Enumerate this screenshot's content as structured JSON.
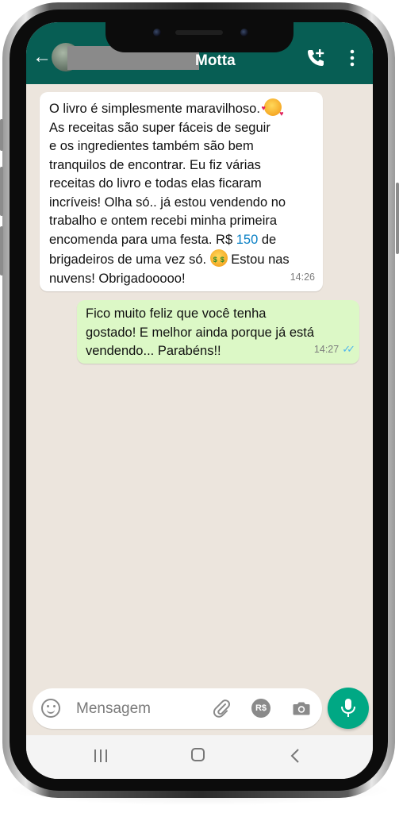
{
  "header": {
    "contact_name": "Motta",
    "accent_color": "#075e54",
    "icons": [
      "back-arrow-icon",
      "avatar",
      "add-call-icon",
      "more-vert-icon"
    ]
  },
  "messages": [
    {
      "direction": "incoming",
      "lines": [
        "O livro é simplesmente maravilhoso.",
        "As receitas são super fáceis de seguir",
        "e os ingredientes também são bem",
        "tranquilos de encontrar. Eu fiz várias",
        "receitas do livro e todas elas ficaram",
        "incríveis! Olha só.. já estou vendendo no",
        "trabalho e ontem recebi minha primeira",
        "encomenda para uma festa. R$",
        "150",
        "de",
        "brigadeiros de uma vez só.",
        "Estou nas",
        "nuvens! Obrigadooooo!"
      ],
      "time": "14:26",
      "emoji": [
        "smiling-face-with-hearts",
        "money-mouth-face"
      ]
    },
    {
      "direction": "outgoing",
      "lines": [
        "Fico muito feliz que você tenha",
        "gostado! E melhor ainda porque já está",
        "vendendo... Parabéns!!"
      ],
      "time": "14:27",
      "status": "read"
    }
  ],
  "composer": {
    "placeholder": "Mensagem",
    "rs_label": "R$",
    "mic_color": "#00a884"
  },
  "colors": {
    "incoming_bubble": "#ffffff",
    "outgoing_bubble": "#dcf8c6",
    "chat_background": "#ece5dd",
    "read_ticks": "#4fb6ec",
    "link_number": "#0a80c5"
  }
}
